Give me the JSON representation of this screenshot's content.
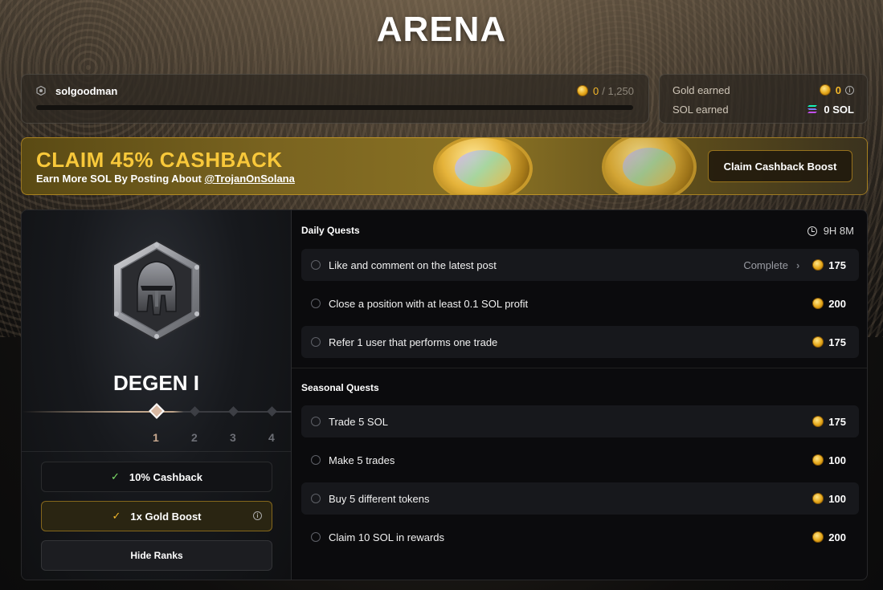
{
  "page": {
    "title": "ARENA"
  },
  "user": {
    "name": "solgoodman",
    "gold_current": "0",
    "gold_max": "/ 1,250",
    "progress_fraction": 0.0
  },
  "earnings": {
    "gold_label": "Gold earned",
    "gold_value": "0",
    "sol_label": "SOL earned",
    "sol_value": "0 SOL"
  },
  "banner": {
    "title": "CLAIM 45% CASHBACK",
    "subtitle_prefix": "Earn More SOL By Posting About",
    "handle": "@TrojanOnSolana",
    "button_label": "Claim Cashback Boost"
  },
  "rank": {
    "name": "DEGEN I",
    "levels": [
      "1",
      "2",
      "3",
      "4"
    ],
    "current_level_index": 0
  },
  "perks": {
    "cashback": "10% Cashback",
    "gold_boost": "1x Gold Boost",
    "hide_ranks": "Hide Ranks"
  },
  "daily": {
    "title": "Daily Quests",
    "timer": "9H 8M",
    "quests": [
      {
        "label": "Like and comment on the latest post",
        "status": "Complete",
        "reward": "175"
      },
      {
        "label": "Close a position with at least 0.1 SOL profit",
        "status": "",
        "reward": "200"
      },
      {
        "label": "Refer 1 user that performs one trade",
        "status": "",
        "reward": "175"
      }
    ]
  },
  "seasonal": {
    "title": "Seasonal Quests",
    "quests": [
      {
        "label": "Trade 5 SOL",
        "reward": "175"
      },
      {
        "label": "Make 5 trades",
        "reward": "100"
      },
      {
        "label": "Buy 5 different tokens",
        "reward": "100"
      },
      {
        "label": "Claim 10 SOL in rewards",
        "reward": "200"
      }
    ]
  },
  "colors": {
    "gold": "#f5b82a",
    "banner_title": "#f8c83a",
    "check_green": "#7ee06a"
  }
}
